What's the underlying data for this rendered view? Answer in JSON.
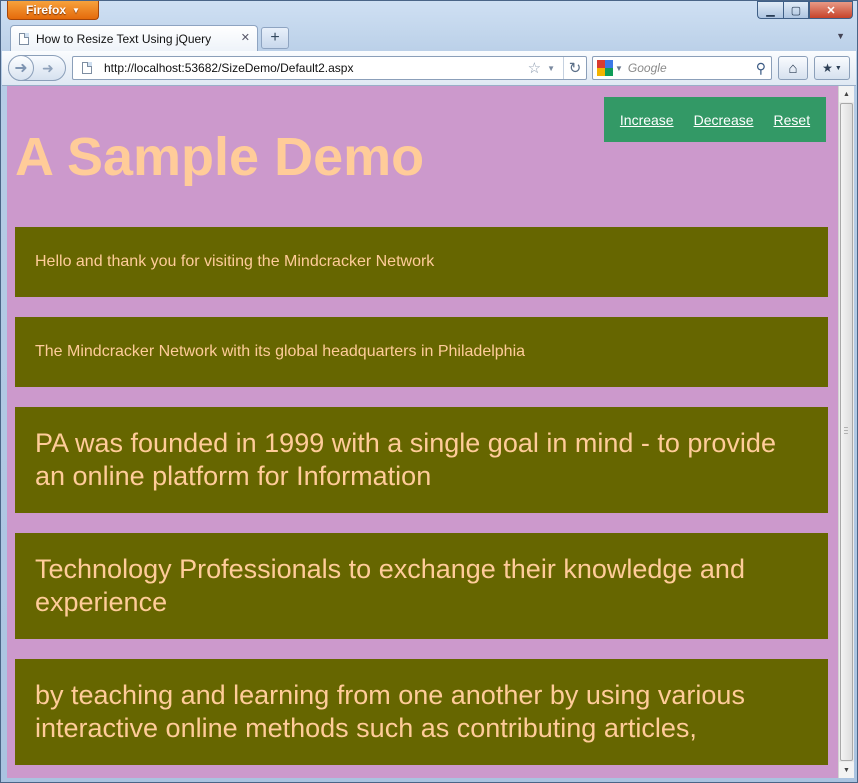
{
  "browser": {
    "app_button": "Firefox",
    "tab_title": "How to Resize Text Using jQuery",
    "url": "http://localhost:53682/SizeDemo/Default2.aspx",
    "search_placeholder": "Google"
  },
  "page": {
    "nav": {
      "increase": "Increase",
      "decrease": "Decrease",
      "reset": "Reset"
    },
    "heading": "A Sample Demo",
    "paragraphs": [
      "Hello and thank you for visiting the Mindcracker Network",
      "The Mindcracker Network with its global headquarters in Philadelphia",
      "PA was founded in 1999 with a single goal in mind - to provide an online platform for Information",
      "Technology Professionals to exchange their knowledge and experience",
      "by teaching and learning from one another by using various interactive online methods such as contributing articles,"
    ]
  },
  "colors": {
    "background": "#cc99cc",
    "heading_text": "#ffcc99",
    "nav_bg": "#339966",
    "paragraph_bg": "#666600",
    "paragraph_text": "#ffcc99"
  }
}
